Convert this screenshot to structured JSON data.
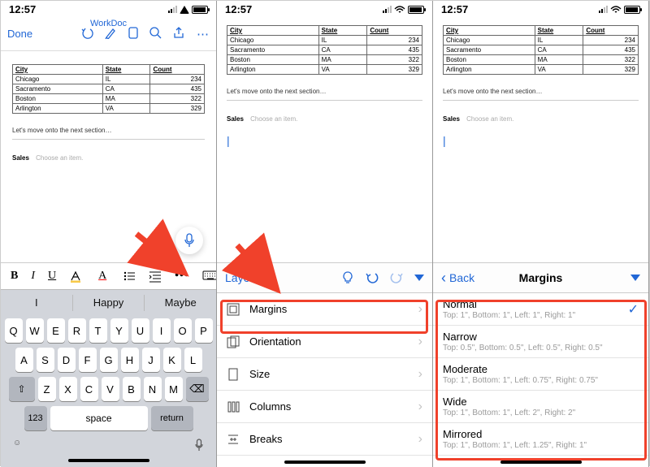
{
  "status": {
    "time": "12:57"
  },
  "screen1": {
    "done": "Done",
    "title": "WorkDoc",
    "paragraph": "Let's move onto the next section…",
    "sales_label": "Sales",
    "sales_choose": "Choose an item.",
    "format": {
      "B": "B",
      "I": "I",
      "U": "U",
      "A": "A"
    },
    "suggestions": [
      "I",
      "Happy",
      "Maybe"
    ],
    "keyboard": {
      "row1": [
        "Q",
        "W",
        "E",
        "R",
        "T",
        "Y",
        "U",
        "I",
        "O",
        "P"
      ],
      "row2": [
        "A",
        "S",
        "D",
        "F",
        "G",
        "H",
        "J",
        "K",
        "L"
      ],
      "row3": [
        "Z",
        "X",
        "C",
        "V",
        "B",
        "N",
        "M"
      ],
      "num": "123",
      "space": "space",
      "return": "return"
    }
  },
  "table": {
    "headers": [
      "City",
      "State",
      "Count"
    ],
    "rows": [
      [
        "Chicago",
        "IL",
        "234"
      ],
      [
        "Sacramento",
        "CA",
        "435"
      ],
      [
        "Boston",
        "MA",
        "322"
      ],
      [
        "Arlington",
        "VA",
        "329"
      ]
    ]
  },
  "screen2": {
    "paragraph": "Let's move onto the next section…",
    "sales_label": "Sales",
    "sales_choose": "Choose an item.",
    "section_title": "Layout",
    "items": [
      {
        "label": "Margins"
      },
      {
        "label": "Orientation"
      },
      {
        "label": "Size"
      },
      {
        "label": "Columns"
      },
      {
        "label": "Breaks"
      }
    ]
  },
  "screen3": {
    "paragraph": "Let's move onto the next section…",
    "sales_label": "Sales",
    "sales_choose": "Choose an item.",
    "back": "Back",
    "section_title": "Margins",
    "options": [
      {
        "name": "Normal",
        "sub": "Top: 1\", Bottom: 1\", Left: 1\", Right: 1\"",
        "checked": true
      },
      {
        "name": "Narrow",
        "sub": "Top: 0.5\", Bottom: 0.5\", Left: 0.5\", Right: 0.5\""
      },
      {
        "name": "Moderate",
        "sub": "Top: 1\", Bottom: 1\", Left: 0.75\", Right: 0.75\""
      },
      {
        "name": "Wide",
        "sub": "Top: 1\", Bottom: 1\", Left: 2\", Right: 2\""
      },
      {
        "name": "Mirrored",
        "sub": "Top: 1\", Bottom: 1\", Left: 1.25\", Right: 1\""
      }
    ]
  },
  "chart_data": {
    "type": "table",
    "headers": [
      "City",
      "State",
      "Count"
    ],
    "rows": [
      [
        "Chicago",
        "IL",
        234
      ],
      [
        "Sacramento",
        "CA",
        435
      ],
      [
        "Boston",
        "MA",
        322
      ],
      [
        "Arlington",
        "VA",
        329
      ]
    ]
  }
}
